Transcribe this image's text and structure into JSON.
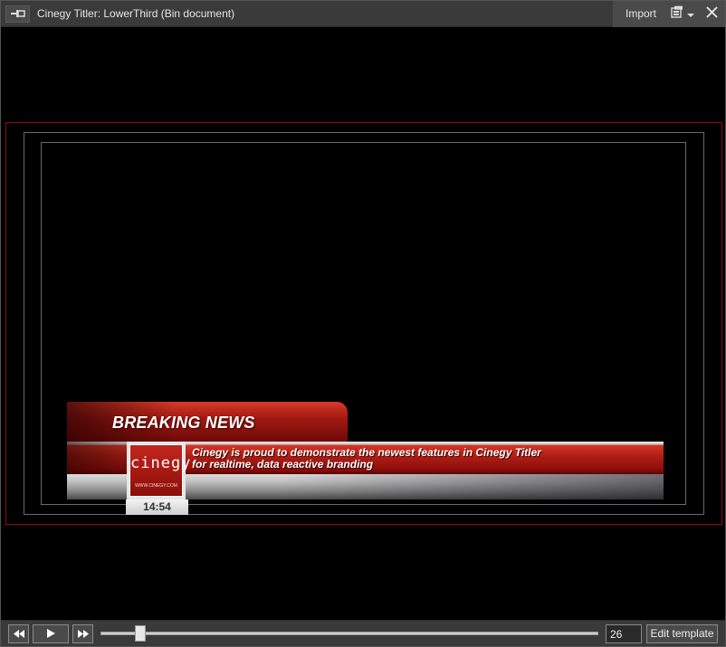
{
  "window": {
    "title": "Cinegy Titler: LowerThird (Bin document)",
    "import_label": "Import"
  },
  "icons": {
    "pin": "pin-icon",
    "layout": "layout-icon",
    "dropdown": "chevron-down-icon",
    "close": "close-icon",
    "rewind": "rewind-icon",
    "play": "play-icon",
    "fast_forward": "fast-forward-icon"
  },
  "preview": {
    "headline": "BREAKING NEWS",
    "ticker_line1": "Cinegy is proud to demonstrate the newest features in Cinegy Titler",
    "ticker_line2": "for realtime, data reactive branding",
    "logo_text": "cinegy",
    "logo_url": "WWW.CINEGY.COM",
    "clock": "14:54"
  },
  "colors": {
    "safe_area_frame": "#8a0a14",
    "guide_frame": "#6a6a6a",
    "brand_red": "#b01e16"
  },
  "controls": {
    "frame_value": "26",
    "edit_template_label": "Edit template"
  }
}
